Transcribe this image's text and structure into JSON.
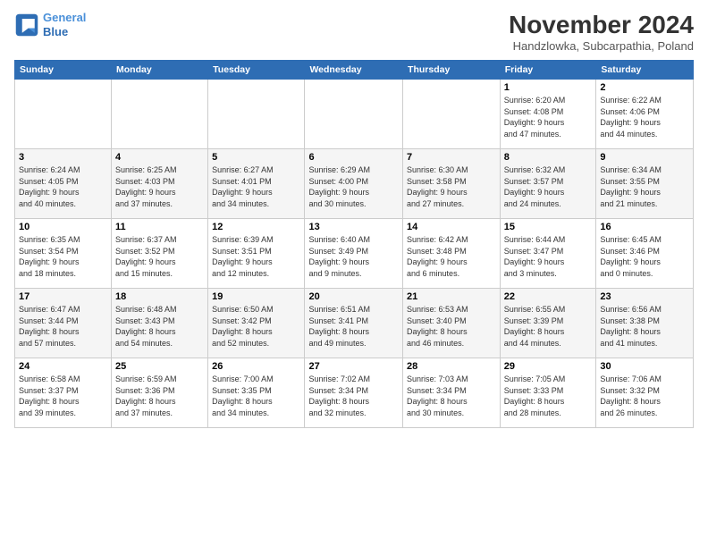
{
  "header": {
    "logo_line1": "General",
    "logo_line2": "Blue",
    "month": "November 2024",
    "location": "Handzlowka, Subcarpathia, Poland"
  },
  "weekdays": [
    "Sunday",
    "Monday",
    "Tuesday",
    "Wednesday",
    "Thursday",
    "Friday",
    "Saturday"
  ],
  "weeks": [
    [
      {
        "day": "",
        "info": ""
      },
      {
        "day": "",
        "info": ""
      },
      {
        "day": "",
        "info": ""
      },
      {
        "day": "",
        "info": ""
      },
      {
        "day": "",
        "info": ""
      },
      {
        "day": "1",
        "info": "Sunrise: 6:20 AM\nSunset: 4:08 PM\nDaylight: 9 hours\nand 47 minutes."
      },
      {
        "day": "2",
        "info": "Sunrise: 6:22 AM\nSunset: 4:06 PM\nDaylight: 9 hours\nand 44 minutes."
      }
    ],
    [
      {
        "day": "3",
        "info": "Sunrise: 6:24 AM\nSunset: 4:05 PM\nDaylight: 9 hours\nand 40 minutes."
      },
      {
        "day": "4",
        "info": "Sunrise: 6:25 AM\nSunset: 4:03 PM\nDaylight: 9 hours\nand 37 minutes."
      },
      {
        "day": "5",
        "info": "Sunrise: 6:27 AM\nSunset: 4:01 PM\nDaylight: 9 hours\nand 34 minutes."
      },
      {
        "day": "6",
        "info": "Sunrise: 6:29 AM\nSunset: 4:00 PM\nDaylight: 9 hours\nand 30 minutes."
      },
      {
        "day": "7",
        "info": "Sunrise: 6:30 AM\nSunset: 3:58 PM\nDaylight: 9 hours\nand 27 minutes."
      },
      {
        "day": "8",
        "info": "Sunrise: 6:32 AM\nSunset: 3:57 PM\nDaylight: 9 hours\nand 24 minutes."
      },
      {
        "day": "9",
        "info": "Sunrise: 6:34 AM\nSunset: 3:55 PM\nDaylight: 9 hours\nand 21 minutes."
      }
    ],
    [
      {
        "day": "10",
        "info": "Sunrise: 6:35 AM\nSunset: 3:54 PM\nDaylight: 9 hours\nand 18 minutes."
      },
      {
        "day": "11",
        "info": "Sunrise: 6:37 AM\nSunset: 3:52 PM\nDaylight: 9 hours\nand 15 minutes."
      },
      {
        "day": "12",
        "info": "Sunrise: 6:39 AM\nSunset: 3:51 PM\nDaylight: 9 hours\nand 12 minutes."
      },
      {
        "day": "13",
        "info": "Sunrise: 6:40 AM\nSunset: 3:49 PM\nDaylight: 9 hours\nand 9 minutes."
      },
      {
        "day": "14",
        "info": "Sunrise: 6:42 AM\nSunset: 3:48 PM\nDaylight: 9 hours\nand 6 minutes."
      },
      {
        "day": "15",
        "info": "Sunrise: 6:44 AM\nSunset: 3:47 PM\nDaylight: 9 hours\nand 3 minutes."
      },
      {
        "day": "16",
        "info": "Sunrise: 6:45 AM\nSunset: 3:46 PM\nDaylight: 9 hours\nand 0 minutes."
      }
    ],
    [
      {
        "day": "17",
        "info": "Sunrise: 6:47 AM\nSunset: 3:44 PM\nDaylight: 8 hours\nand 57 minutes."
      },
      {
        "day": "18",
        "info": "Sunrise: 6:48 AM\nSunset: 3:43 PM\nDaylight: 8 hours\nand 54 minutes."
      },
      {
        "day": "19",
        "info": "Sunrise: 6:50 AM\nSunset: 3:42 PM\nDaylight: 8 hours\nand 52 minutes."
      },
      {
        "day": "20",
        "info": "Sunrise: 6:51 AM\nSunset: 3:41 PM\nDaylight: 8 hours\nand 49 minutes."
      },
      {
        "day": "21",
        "info": "Sunrise: 6:53 AM\nSunset: 3:40 PM\nDaylight: 8 hours\nand 46 minutes."
      },
      {
        "day": "22",
        "info": "Sunrise: 6:55 AM\nSunset: 3:39 PM\nDaylight: 8 hours\nand 44 minutes."
      },
      {
        "day": "23",
        "info": "Sunrise: 6:56 AM\nSunset: 3:38 PM\nDaylight: 8 hours\nand 41 minutes."
      }
    ],
    [
      {
        "day": "24",
        "info": "Sunrise: 6:58 AM\nSunset: 3:37 PM\nDaylight: 8 hours\nand 39 minutes."
      },
      {
        "day": "25",
        "info": "Sunrise: 6:59 AM\nSunset: 3:36 PM\nDaylight: 8 hours\nand 37 minutes."
      },
      {
        "day": "26",
        "info": "Sunrise: 7:00 AM\nSunset: 3:35 PM\nDaylight: 8 hours\nand 34 minutes."
      },
      {
        "day": "27",
        "info": "Sunrise: 7:02 AM\nSunset: 3:34 PM\nDaylight: 8 hours\nand 32 minutes."
      },
      {
        "day": "28",
        "info": "Sunrise: 7:03 AM\nSunset: 3:34 PM\nDaylight: 8 hours\nand 30 minutes."
      },
      {
        "day": "29",
        "info": "Sunrise: 7:05 AM\nSunset: 3:33 PM\nDaylight: 8 hours\nand 28 minutes."
      },
      {
        "day": "30",
        "info": "Sunrise: 7:06 AM\nSunset: 3:32 PM\nDaylight: 8 hours\nand 26 minutes."
      }
    ]
  ]
}
